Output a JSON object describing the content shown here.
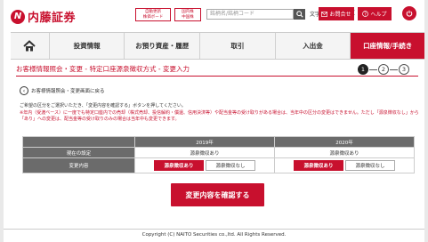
{
  "header": {
    "logo_text": "内藤証券",
    "logo_mark": "N",
    "btn_auto_trade": "自動更新\n株価ボード",
    "btn_quotes": "国内株\n中国株",
    "search_placeholder": "銘柄名/銘柄コード",
    "font_size_label": "文字サイズ",
    "font_small": "小",
    "font_medium": "中",
    "font_large": "大",
    "messages_label": "お問合せ",
    "help_label": "ヘルプ"
  },
  "nav": {
    "items": [
      {
        "label": "投資情報"
      },
      {
        "label": "お預り資産・履歴"
      },
      {
        "label": "取引"
      },
      {
        "label": "入出金"
      },
      {
        "label": "口座情報/手続き"
      }
    ]
  },
  "page": {
    "title": "お客様情報照会・変更 - 特定口座源泉徴収方式 - 変更入力",
    "steps": [
      "1",
      "2",
      "3"
    ],
    "back_link": "お客様情報照会・変更画面に戻る",
    "note1": "ご希望の区分をご選択いただき、「変更内容を確認する」ボタンを押してください。",
    "note2": "※年内（受渡ベース）に一度でも特定口座内での売却（株式売却、投信解約・償還、信用決済等）や配当金等の受け取りがある場合は、当年中の区分の変更はできません。ただし「源泉徴収なし」から「あり」への変更は、配当金等の受け取りのみの場合は当年中も変更できます。"
  },
  "table": {
    "years": [
      "2019年",
      "2020年"
    ],
    "row_current": "現在の設定",
    "current_values": [
      "源泉徴収あり",
      "源泉徴収あり"
    ],
    "row_change": "変更内容",
    "option_with": "源泉徴収あり",
    "option_without": "源泉徴収なし"
  },
  "confirm_label": "変更内容を確認する",
  "footer": "Copyright (C) NAITO Securities co.,ltd. All Rights Reserved.",
  "colors": {
    "accent": "#c8102e",
    "header_gray": "#6b6b6b"
  }
}
